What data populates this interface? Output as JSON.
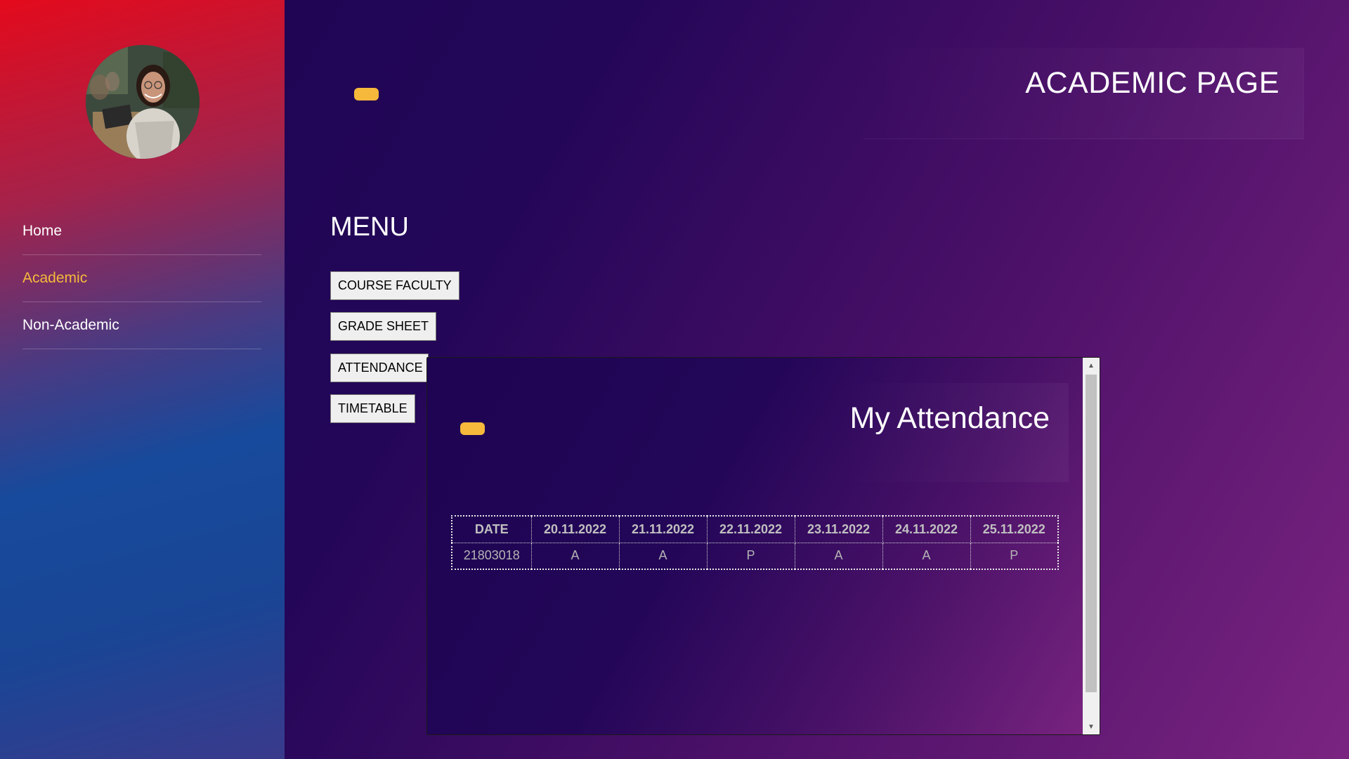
{
  "sidebar": {
    "items": [
      {
        "label": "Home"
      },
      {
        "label": "Academic"
      },
      {
        "label": "Non-Academic"
      }
    ],
    "active_color": "#f6b93b"
  },
  "header": {
    "title": "ACADEMIC PAGE"
  },
  "menu": {
    "title": "MENU",
    "buttons": [
      {
        "label": "COURSE FACULTY"
      },
      {
        "label": "GRADE SHEET"
      },
      {
        "label": "ATTENDANCE"
      },
      {
        "label": "TIMETABLE"
      }
    ]
  },
  "attendance": {
    "title": "My Attendance",
    "headers": [
      "DATE",
      "20.11.2022",
      "21.11.2022",
      "22.11.2022",
      "23.11.2022",
      "24.11.2022",
      "25.11.2022"
    ],
    "rows": [
      [
        "21803018",
        "A",
        "A",
        "P",
        "A",
        "A",
        "P"
      ]
    ]
  },
  "colors": {
    "accent": "#f6b93b",
    "sidebar_top": "#e40a1c",
    "sidebar_mid": "#174a9c",
    "background_dark": "#1e0452",
    "background_light": "#7a2480"
  }
}
